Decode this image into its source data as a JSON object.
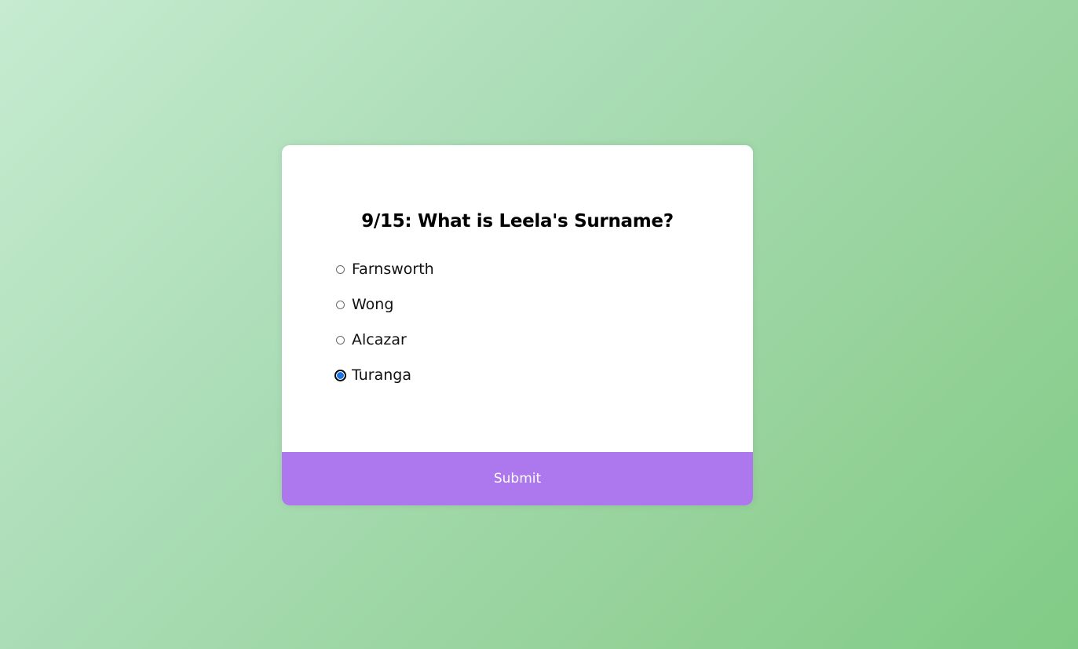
{
  "quiz": {
    "question": "9/15: What is Leela's Surname?",
    "answers": [
      {
        "label": "Farnsworth",
        "selected": false
      },
      {
        "label": "Wong",
        "selected": false
      },
      {
        "label": "Alcazar",
        "selected": false
      },
      {
        "label": "Turanga",
        "selected": true
      }
    ],
    "submit_label": "Submit"
  },
  "colors": {
    "submit_background": "#ad78ee",
    "selected_radio": "#1a73e8",
    "background_start": "#c6ebd0",
    "background_end": "#80cb86"
  },
  "icons": {
    "radio": "radio-button-icon"
  }
}
